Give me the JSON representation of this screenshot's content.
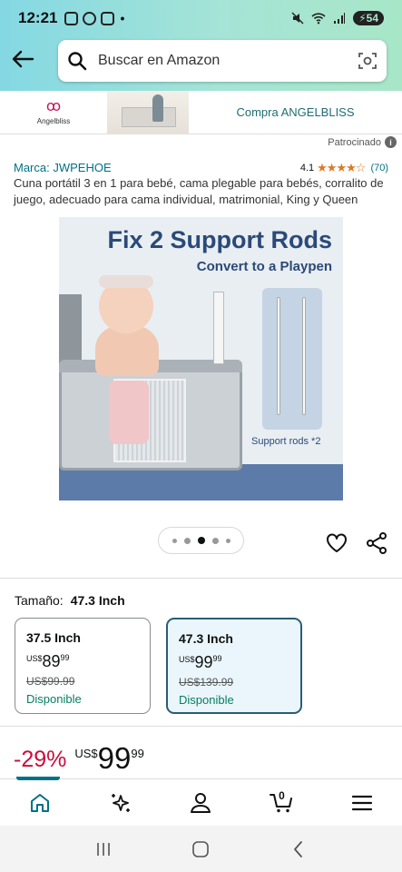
{
  "status_bar": {
    "time": "12:21",
    "battery": "54",
    "notification_dot": "•"
  },
  "search": {
    "placeholder": "Buscar en Amazon"
  },
  "banner": {
    "brand_logo_text": "Angelbliss",
    "cta": "Compra ANGELBLISS"
  },
  "sponsored": {
    "label": "Patrocinado",
    "info_glyph": "i"
  },
  "product": {
    "brand": "Marca: JWPEHOE",
    "rating_value": "4.1",
    "rating_stars": "★★★★☆",
    "rating_count": "(70)",
    "title": "Cuna portátil 3 en 1 para bebé, cama plegable para bebés, corralito de juego, adecuado para cama individual, matrimonial, King y Queen",
    "image": {
      "headline": "Fix 2 Support Rods",
      "subhead": "Convert to a Playpen",
      "rods_caption": "Support rods *2"
    }
  },
  "carousel": {
    "total": 5,
    "active_index": 2
  },
  "size": {
    "label": "Tamaño:",
    "selected": "47.3 Inch",
    "options": [
      {
        "size": "37.5 Inch",
        "currency": "US$",
        "price_int": "89",
        "price_cents": "99",
        "list_price": "US$99.99",
        "availability": "Disponible",
        "selected": false
      },
      {
        "size": "47.3 Inch",
        "currency": "US$",
        "price_int": "99",
        "price_cents": "99",
        "list_price": "US$139.99",
        "availability": "Disponible",
        "selected": true
      }
    ]
  },
  "price": {
    "discount": "-29%",
    "currency": "US$",
    "int": "99",
    "cents": "99"
  },
  "tabbar": {
    "items": [
      "home-icon",
      "sparkle-icon",
      "account-icon",
      "cart-icon",
      "menu-icon"
    ],
    "cart_count": "0"
  },
  "colors": {
    "link": "#007185",
    "discount": "#CC0C39",
    "available": "#067D62",
    "accent_dark": "#2a5d73"
  }
}
